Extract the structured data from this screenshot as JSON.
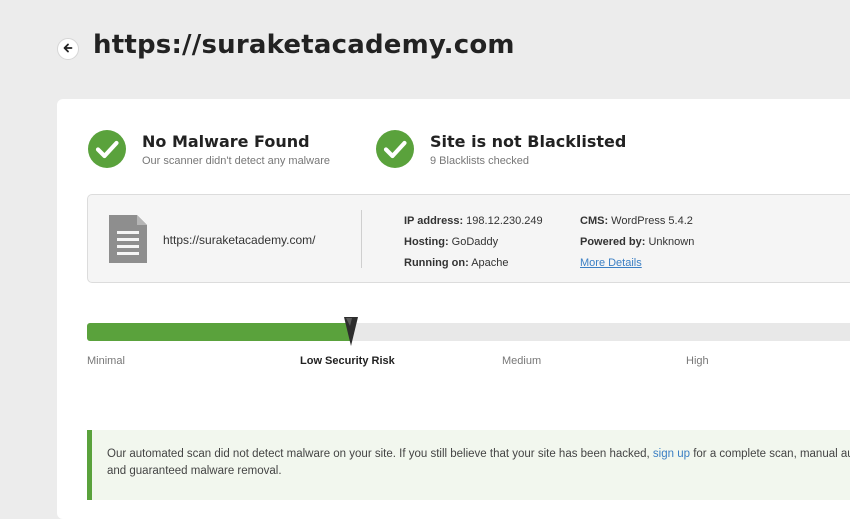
{
  "header": {
    "title": "https://suraketacademy.com"
  },
  "statuses": [
    {
      "title": "No Malware Found",
      "subtitle": "Our scanner didn't detect any malware"
    },
    {
      "title": "Site is not Blacklisted",
      "subtitle": "9 Blacklists checked"
    }
  ],
  "site_info": {
    "url": "https://suraketacademy.com/",
    "ip_label": "IP address:",
    "ip_value": "198.12.230.249",
    "hosting_label": "Hosting:",
    "hosting_value": "GoDaddy",
    "running_label": "Running on:",
    "running_value": "Apache",
    "cms_label": "CMS:",
    "cms_value": "WordPress 5.4.2",
    "powered_label": "Powered by:",
    "powered_value": "Unknown",
    "more_details": "More Details"
  },
  "risk_meter": {
    "level_fraction": 0.33,
    "labels": [
      "Minimal",
      "Low Security Risk",
      "Medium",
      "High"
    ],
    "active_index": 1
  },
  "notice": {
    "text_before": "Our automated scan did not detect malware on your site. If you still believe that your site has been hacked, ",
    "link": "sign up",
    "text_after": " for a complete scan, manual audit, and guaranteed malware removal."
  },
  "colors": {
    "accent_green": "#5aa23c",
    "link_blue": "#3b7fc4"
  },
  "icons": [
    "back-arrow-icon",
    "checkmark-icon",
    "document-icon",
    "needle-icon"
  ]
}
